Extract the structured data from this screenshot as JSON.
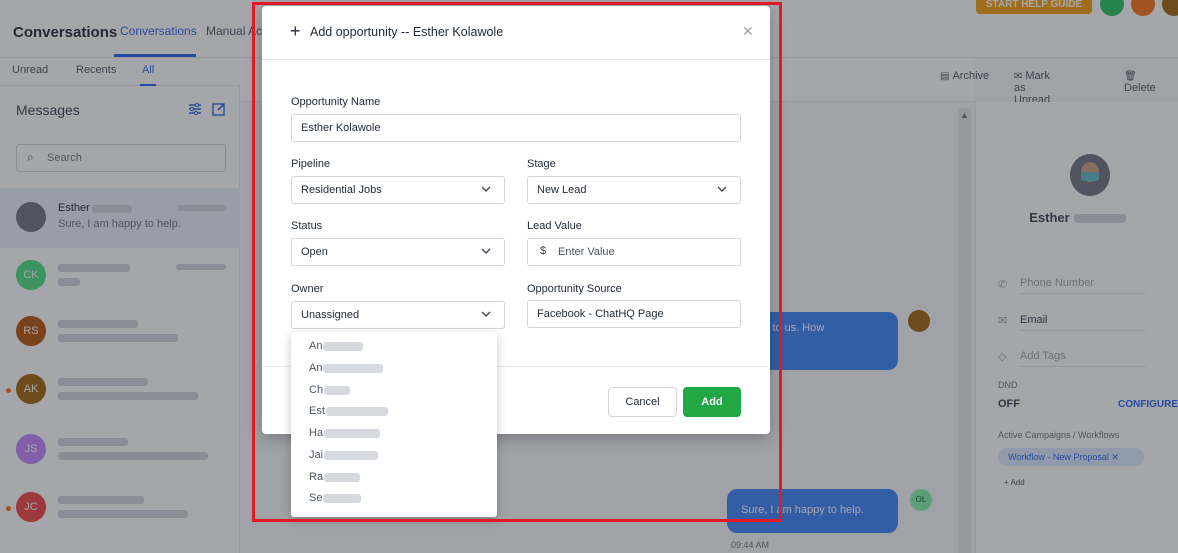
{
  "app": {
    "title": "Conversations",
    "top_tabs": [
      "Conversations",
      "Manual Act"
    ],
    "help_button": "START HELP GUIDE",
    "sub_tabs": [
      "Unread",
      "Recents",
      "All"
    ],
    "messages_title": "Messages",
    "search_placeholder": "Search",
    "toolbar": {
      "archive": "Archive",
      "mark_unread": "Mark as Unread",
      "delete": "Delete"
    },
    "conversations": [
      {
        "initials": "",
        "name": "Esther",
        "snippet": "Sure, I am happy to help.",
        "selected": true
      },
      {
        "initials": "CK"
      },
      {
        "initials": "RS"
      },
      {
        "initials": "AK"
      },
      {
        "initials": "JS"
      },
      {
        "initials": "JC"
      }
    ],
    "chat": {
      "incoming_bubble": "out to us. How",
      "outgoing_bubble": "Sure, I am happy to help.",
      "outgoing_avatar": "OL",
      "time": "09:44 AM"
    },
    "contact_panel": {
      "name": "Esther",
      "phone_placeholder": "Phone Number",
      "email_label": "Email",
      "tags_placeholder": "Add Tags",
      "dnd_label": "DND",
      "dnd_value": "OFF",
      "configure": "CONFIGURE",
      "campaigns_label": "Active Campaigns / Workflows",
      "workflow_pill": "Workflow - New Proposal",
      "add_label": "+ Add"
    }
  },
  "modal": {
    "title": "Add opportunity -- Esther Kolawole",
    "fields": {
      "opportunity_name": {
        "label": "Opportunity Name",
        "value": "Esther Kolawole"
      },
      "pipeline": {
        "label": "Pipeline",
        "value": "Residential Jobs"
      },
      "stage": {
        "label": "Stage",
        "value": "New Lead"
      },
      "status": {
        "label": "Status",
        "value": "Open"
      },
      "lead_value": {
        "label": "Lead Value",
        "currency": "$",
        "placeholder": "Enter Value"
      },
      "owner": {
        "label": "Owner",
        "value": "Unassigned"
      },
      "source": {
        "label": "Opportunity Source",
        "value": "Facebook - ChatHQ Page"
      }
    },
    "cancel_label": "Cancel",
    "add_label": "Add"
  },
  "owner_options": [
    "An",
    "An",
    "Ch",
    "Est",
    "Ha",
    "Jai",
    "Ra",
    "Se"
  ],
  "colors": {
    "accent": "#2563eb",
    "add_button": "#22a745",
    "highlight": "#e01b24",
    "bubble": "#3b82f6"
  }
}
